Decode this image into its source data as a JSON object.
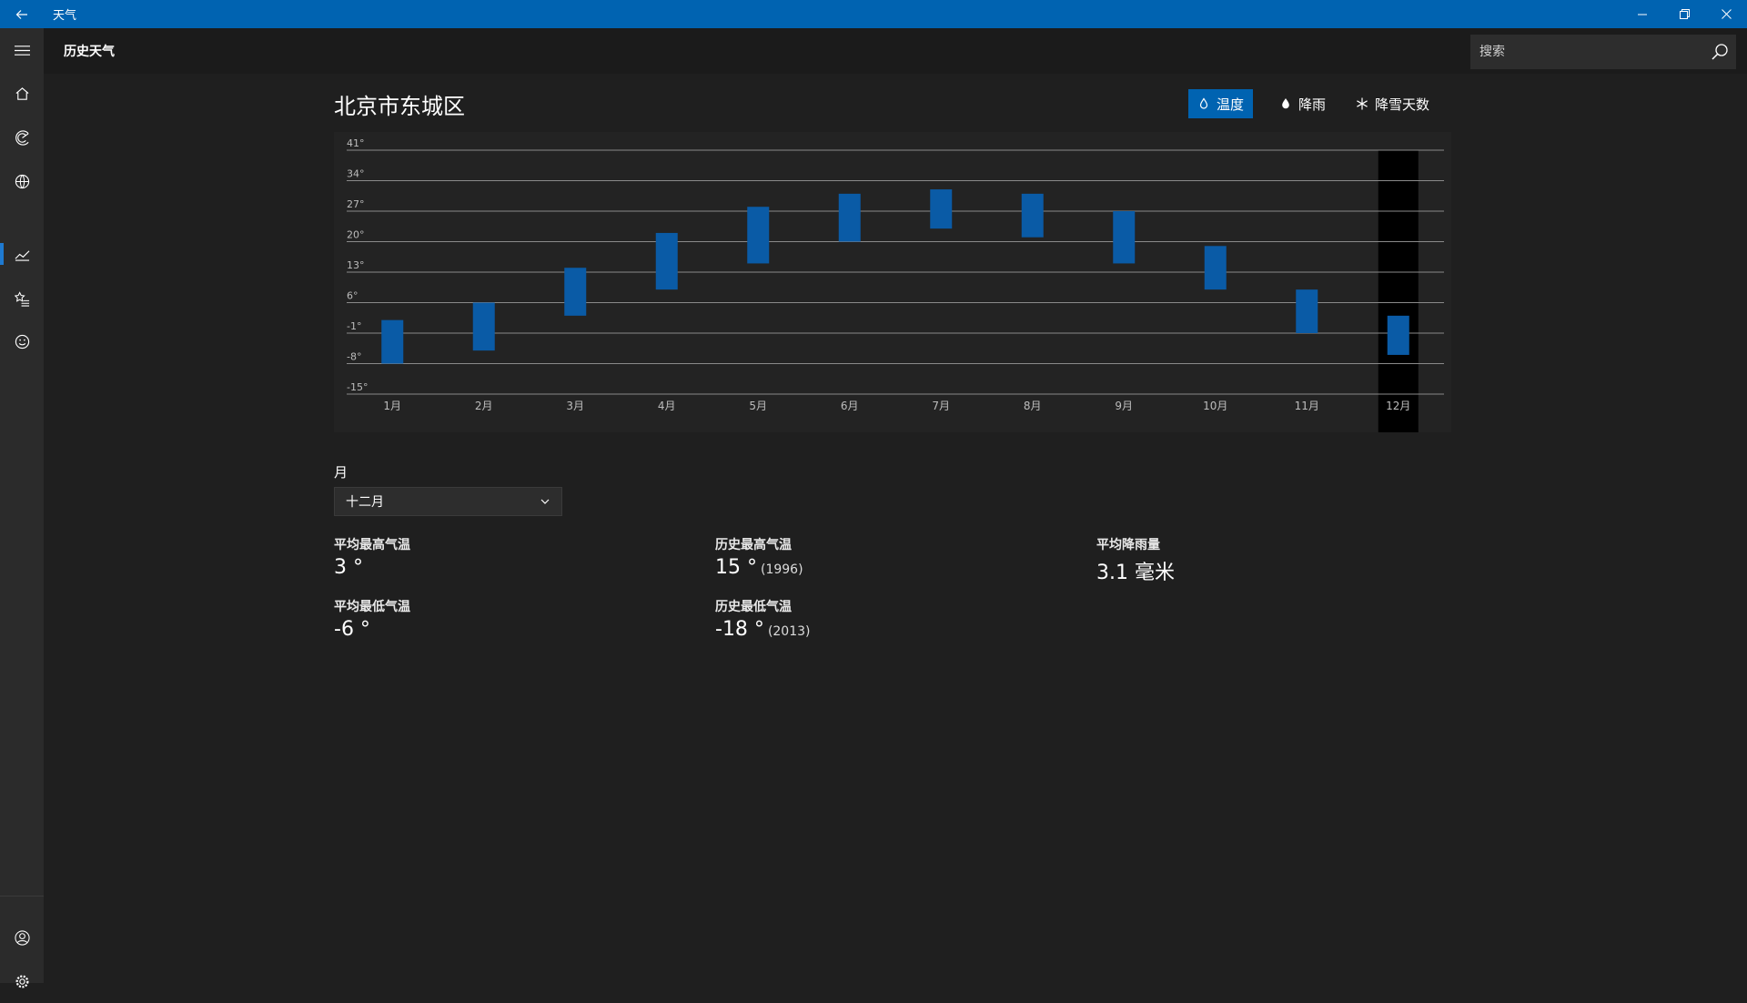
{
  "app": {
    "title": "天气"
  },
  "header": {
    "title": "历史天气"
  },
  "search": {
    "placeholder": "搜索"
  },
  "location": "北京市东城区",
  "tabs": [
    {
      "label": "温度",
      "active": true,
      "icon": "thermometer-icon"
    },
    {
      "label": "降雨",
      "active": false,
      "icon": "raindrop-icon"
    },
    {
      "label": "降雪天数",
      "active": false,
      "icon": "snowflake-icon"
    }
  ],
  "chart_data": {
    "type": "bar",
    "categories": [
      "1月",
      "2月",
      "3月",
      "4月",
      "5月",
      "6月",
      "7月",
      "8月",
      "9月",
      "10月",
      "11月",
      "12月"
    ],
    "y_ticks": [
      "41°",
      "34°",
      "27°",
      "20°",
      "13°",
      "6°",
      "-1°",
      "-8°",
      "-15°"
    ],
    "ylim": [
      -15,
      41
    ],
    "series": [
      {
        "low": [
          -8,
          -5,
          3,
          9,
          15,
          20,
          23,
          21,
          15,
          9,
          -1,
          -6
        ],
        "high": [
          2,
          6,
          14,
          22,
          28,
          31,
          32,
          31,
          27,
          19,
          9,
          3
        ]
      }
    ],
    "selected_index": 11,
    "bar_color": "#0a5ba6"
  },
  "month_picker": {
    "label": "月",
    "selected": "十二月"
  },
  "stats": {
    "avg_high": {
      "label": "平均最高气温",
      "value": "3 °"
    },
    "avg_low": {
      "label": "平均最低气温",
      "value": "-6 °"
    },
    "record_high": {
      "label": "历史最高气温",
      "value": "15 °",
      "year": "(1996)"
    },
    "record_low": {
      "label": "历史最低气温",
      "value": "-18 °",
      "year": "(2013)"
    },
    "avg_rain": {
      "label": "平均降雨量",
      "value": "3.1 毫米"
    }
  },
  "colors": {
    "accent": "#0063b1",
    "background": "#1f1f1f"
  }
}
